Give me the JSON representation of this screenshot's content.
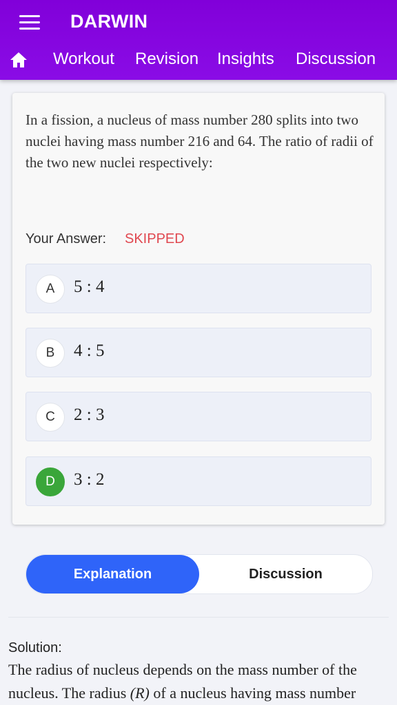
{
  "app": {
    "title": "DARWIN"
  },
  "nav": {
    "icons": {
      "menu": "menu-icon",
      "home": "home-icon"
    },
    "tabs": [
      "Workout",
      "Revision",
      "Insights",
      "Discussion"
    ]
  },
  "question": {
    "text": "In a fission, a nucleus of mass number 280 splits into two nuclei having mass number 216 and 64. The ratio of radii of the two new nuclei respectively:",
    "answer_label": "Your Answer:",
    "answer_value": "SKIPPED",
    "options": [
      {
        "letter": "A",
        "text": "5 : 4"
      },
      {
        "letter": "B",
        "text": "4 : 5"
      },
      {
        "letter": "C",
        "text": "2 : 3"
      },
      {
        "letter": "D",
        "text": "3 : 2"
      }
    ],
    "correct_option": "D"
  },
  "tabs": {
    "explanation": "Explanation",
    "discussion": "Discussion",
    "active": "Explanation"
  },
  "solution": {
    "label": "Solution:",
    "text_part1": "The radius of nucleus depends on the mass number of the nucleus. The radius ",
    "math_r": "(R)",
    "text_part2": " of a nucleus having mass number"
  },
  "colors": {
    "header": "#8100d9",
    "answer_skipped": "#e0474f",
    "correct": "#3aa63a",
    "active_tab": "#2f64f9"
  }
}
